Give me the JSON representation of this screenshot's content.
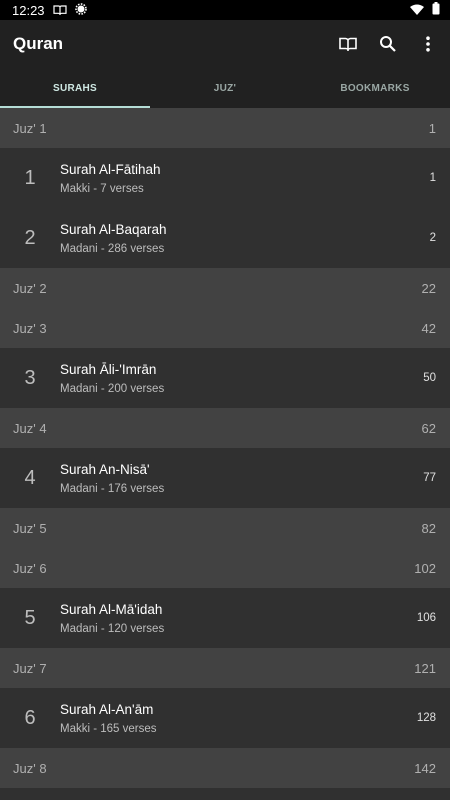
{
  "status_bar": {
    "time": "12:23"
  },
  "app_bar": {
    "title": "Quran"
  },
  "tabs": [
    {
      "label": "SURAHS",
      "active": true
    },
    {
      "label": "JUZ'",
      "active": false
    },
    {
      "label": "BOOKMARKS",
      "active": false
    }
  ],
  "rows": [
    {
      "kind": "juz",
      "label": "Juz' 1",
      "page": "1"
    },
    {
      "kind": "surah",
      "number": "1",
      "name": "Surah Al-Fātihah",
      "meta": "Makki - 7 verses",
      "page": "1"
    },
    {
      "kind": "surah",
      "number": "2",
      "name": "Surah Al-Baqarah",
      "meta": "Madani - 286 verses",
      "page": "2"
    },
    {
      "kind": "juz",
      "label": "Juz' 2",
      "page": "22"
    },
    {
      "kind": "juz",
      "label": "Juz' 3",
      "page": "42"
    },
    {
      "kind": "surah",
      "number": "3",
      "name": "Surah Āli-'Imrān",
      "meta": "Madani - 200 verses",
      "page": "50"
    },
    {
      "kind": "juz",
      "label": "Juz' 4",
      "page": "62"
    },
    {
      "kind": "surah",
      "number": "4",
      "name": "Surah An-Nisā'",
      "meta": "Madani - 176 verses",
      "page": "77"
    },
    {
      "kind": "juz",
      "label": "Juz' 5",
      "page": "82"
    },
    {
      "kind": "juz",
      "label": "Juz' 6",
      "page": "102"
    },
    {
      "kind": "surah",
      "number": "5",
      "name": "Surah Al-Mā'idah",
      "meta": "Madani - 120 verses",
      "page": "106"
    },
    {
      "kind": "juz",
      "label": "Juz' 7",
      "page": "121"
    },
    {
      "kind": "surah",
      "number": "6",
      "name": "Surah Al-An'ām",
      "meta": "Makki - 165 verses",
      "page": "128"
    },
    {
      "kind": "juz",
      "label": "Juz' 8",
      "page": "142"
    }
  ]
}
